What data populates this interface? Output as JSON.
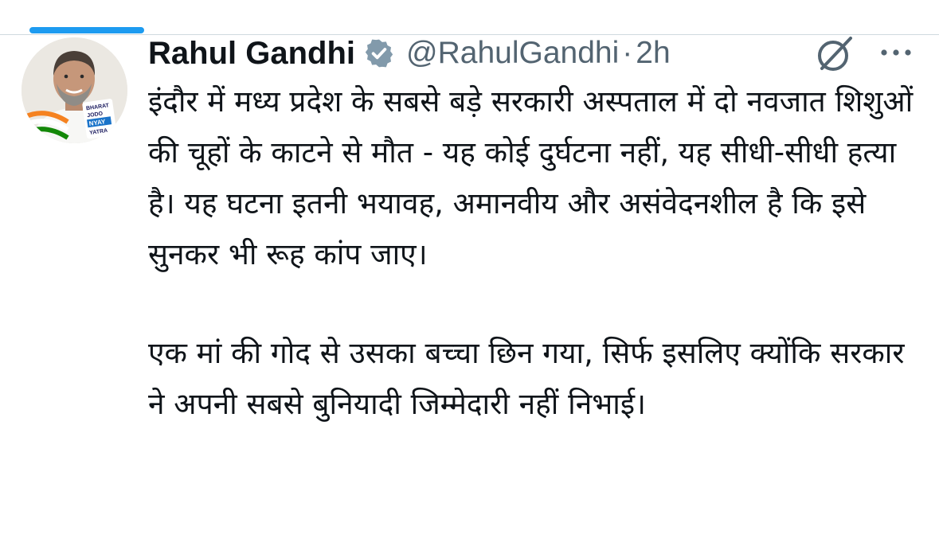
{
  "colors": {
    "accent": "#1d9bf0",
    "text_primary": "#0f1419",
    "text_secondary": "#536471",
    "divider": "#cfd9de"
  },
  "tweet": {
    "author_name": "Rahul Gandhi",
    "author_handle": "@RahulGandhi",
    "separator": "·",
    "timestamp": "2h",
    "verified_icon": "verified-badge-icon",
    "grok_icon": "grok-icon",
    "more_icon": "more-options-icon",
    "avatar_text": {
      "line1": "BHARAT",
      "line2": "JODO",
      "line3": "NYAY",
      "line4": "YATRA"
    },
    "paragraphs": [
      "इंदौर में मध्य प्रदेश के सबसे बड़े सरकारी अस्पताल में दो नवजात शिशुओं की चूहों के काटने से मौत - यह कोई दुर्घटना नहीं, यह सीधी-सीधी हत्या है। यह घटना इतनी भयावह, अमानवीय और असंवेदनशील है कि इसे सुनकर भी रूह कांप जाए।",
      "एक मां की गोद से उसका बच्चा छिन गया, सिर्फ इसलिए क्योंकि सरकार ने अपनी सबसे बुनियादी जिम्मेदारी नहीं निभाई।"
    ]
  }
}
